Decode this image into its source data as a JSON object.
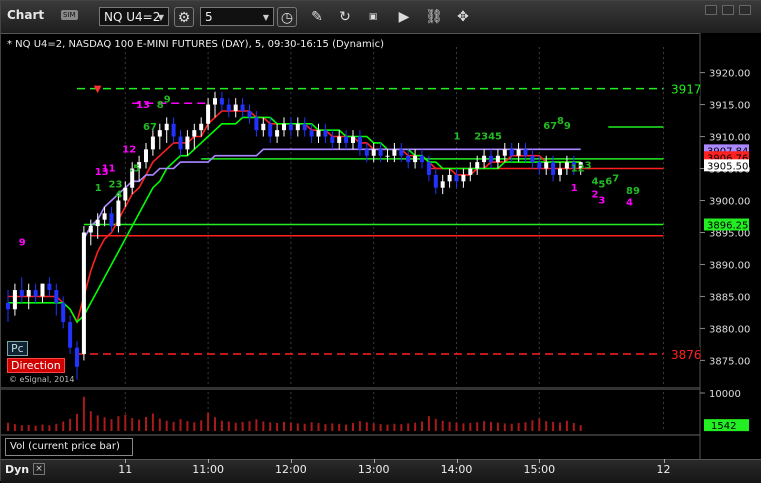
{
  "toolbar": {
    "title": "Chart",
    "sim_badge": "SIM",
    "symbol": "NQ U4=2",
    "interval": "5",
    "icons": [
      "gear-icon",
      "clock-icon",
      "pencil-icon",
      "refresh-icon",
      "get-icon",
      "play-icon",
      "link-icon"
    ]
  },
  "header": {
    "text": "* NQ U4=2, NASDAQ 100 E-MINI FUTURES (DAY), 5, 09:30-16:15 (Dynamic)"
  },
  "badges": {
    "pc": "Pc",
    "direction": "Direction",
    "copyright": "© eSignal, 2014"
  },
  "volume_panel": {
    "label": "Vol (current price bar)"
  },
  "bottom": {
    "dyn": "Dyn"
  },
  "colors": {
    "up_candle": "#ffffff",
    "down_candle": "#2233ff",
    "ema_red": "#ff2020",
    "ema_green": "#00ff00",
    "ma_purple": "#aa88ff",
    "level_green": "#22ee22",
    "level_red": "#ff2020",
    "magenta": "#ff00ff",
    "count_green": "#22bb22"
  },
  "chart_data": {
    "type": "candlestick",
    "ylim": [
      3871,
      3924
    ],
    "y_ticks": [
      3875,
      3880,
      3885,
      3890,
      3895,
      3900,
      3905,
      3910,
      3915,
      3920
    ],
    "x_tick_labels": [
      {
        "label": "11",
        "i": 17
      },
      {
        "label": "11:00",
        "i": 29
      },
      {
        "label": "12:00",
        "i": 41
      },
      {
        "label": "13:00",
        "i": 53
      },
      {
        "label": "14:00",
        "i": 65
      },
      {
        "label": "15:00",
        "i": 77
      },
      {
        "label": "12",
        "i": 95
      }
    ],
    "price_labels": [
      {
        "label": "3917",
        "value": 3917.5,
        "color": "#22ee22"
      },
      {
        "label": "3876",
        "value": 3876,
        "color": "#ff2020"
      },
      {
        "label": "3907.84",
        "value": 3907.84,
        "color": "#aa88ff"
      },
      {
        "label": "3906.76",
        "value": 3906.76,
        "color": "#ff2020"
      },
      {
        "label": "3905.50",
        "value": 3905.5,
        "color": "#ffffff"
      },
      {
        "label": "3896.25",
        "value": 3896.25,
        "color": "#22ee22"
      }
    ],
    "volume_scale": {
      "label": "10000",
      "current": "1542"
    },
    "candles": [
      [
        3884,
        3886,
        3881,
        3883
      ],
      [
        3883,
        3887,
        3882,
        3886
      ],
      [
        3886,
        3888,
        3884,
        3885
      ],
      [
        3885,
        3887,
        3883,
        3886
      ],
      [
        3886,
        3887,
        3884,
        3885
      ],
      [
        3885,
        3887,
        3884,
        3887
      ],
      [
        3887,
        3888,
        3885,
        3886
      ],
      [
        3886,
        3887,
        3882,
        3884
      ],
      [
        3884,
        3885,
        3880,
        3881
      ],
      [
        3881,
        3882,
        3876,
        3877
      ],
      [
        3877,
        3878,
        3872,
        3874
      ],
      [
        3876,
        3896,
        3875,
        3895
      ],
      [
        3895,
        3897,
        3893,
        3896
      ],
      [
        3896,
        3898,
        3894,
        3897
      ],
      [
        3897,
        3899,
        3896,
        3898
      ],
      [
        3898,
        3899,
        3895,
        3896
      ],
      [
        3896,
        3901,
        3895,
        3900
      ],
      [
        3900,
        3903,
        3899,
        3902
      ],
      [
        3902,
        3906,
        3901,
        3905
      ],
      [
        3905,
        3907,
        3903,
        3906
      ],
      [
        3906,
        3909,
        3905,
        3908
      ],
      [
        3908,
        3911,
        3907,
        3910
      ],
      [
        3910,
        3912,
        3908,
        3911
      ],
      [
        3911,
        3913,
        3909,
        3912
      ],
      [
        3912,
        3913,
        3909,
        3910
      ],
      [
        3910,
        3911,
        3907,
        3908
      ],
      [
        3908,
        3911,
        3907,
        3910
      ],
      [
        3910,
        3912,
        3908,
        3911
      ],
      [
        3911,
        3913,
        3910,
        3912
      ],
      [
        3912,
        3916,
        3911,
        3915
      ],
      [
        3915,
        3917,
        3913,
        3916
      ],
      [
        3916,
        3917,
        3914,
        3915
      ],
      [
        3915,
        3916,
        3913,
        3914
      ],
      [
        3914,
        3916,
        3913,
        3915
      ],
      [
        3915,
        3916,
        3913,
        3914
      ],
      [
        3914,
        3915,
        3912,
        3913
      ],
      [
        3913,
        3914,
        3910,
        3911
      ],
      [
        3911,
        3913,
        3910,
        3912
      ],
      [
        3912,
        3913,
        3909,
        3910
      ],
      [
        3910,
        3912,
        3909,
        3911
      ],
      [
        3911,
        3913,
        3910,
        3912
      ],
      [
        3912,
        3913,
        3910,
        3911
      ],
      [
        3911,
        3913,
        3910,
        3912
      ],
      [
        3912,
        3913,
        3910,
        3911
      ],
      [
        3911,
        3912,
        3909,
        3910
      ],
      [
        3910,
        3912,
        3909,
        3911
      ],
      [
        3911,
        3912,
        3909,
        3910
      ],
      [
        3910,
        3911,
        3908,
        3909
      ],
      [
        3909,
        3911,
        3908,
        3910
      ],
      [
        3910,
        3911,
        3908,
        3909
      ],
      [
        3909,
        3911,
        3908,
        3910
      ],
      [
        3910,
        3911,
        3907,
        3908
      ],
      [
        3908,
        3909,
        3906,
        3907
      ],
      [
        3907,
        3909,
        3906,
        3908
      ],
      [
        3908,
        3909,
        3906,
        3907
      ],
      [
        3907,
        3908,
        3906,
        3907
      ],
      [
        3907,
        3909,
        3906,
        3908
      ],
      [
        3908,
        3909,
        3906,
        3907
      ],
      [
        3907,
        3908,
        3905,
        3906
      ],
      [
        3906,
        3908,
        3905,
        3907
      ],
      [
        3907,
        3908,
        3905,
        3906
      ],
      [
        3906,
        3907,
        3903,
        3904
      ],
      [
        3904,
        3905,
        3901,
        3902
      ],
      [
        3902,
        3904,
        3901,
        3903
      ],
      [
        3903,
        3905,
        3902,
        3904
      ],
      [
        3904,
        3905,
        3902,
        3903
      ],
      [
        3903,
        3905,
        3902,
        3904
      ],
      [
        3904,
        3906,
        3903,
        3905
      ],
      [
        3905,
        3907,
        3904,
        3906
      ],
      [
        3906,
        3908,
        3905,
        3907
      ],
      [
        3907,
        3908,
        3905,
        3906
      ],
      [
        3906,
        3908,
        3905,
        3907
      ],
      [
        3907,
        3909,
        3906,
        3908
      ],
      [
        3908,
        3909,
        3906,
        3907
      ],
      [
        3907,
        3909,
        3906,
        3908
      ],
      [
        3908,
        3909,
        3906,
        3907
      ],
      [
        3907,
        3908,
        3905,
        3906
      ],
      [
        3906,
        3907,
        3904,
        3905
      ],
      [
        3905,
        3907,
        3904,
        3906
      ],
      [
        3906,
        3907,
        3903,
        3904
      ],
      [
        3904,
        3906,
        3903,
        3905
      ],
      [
        3905,
        3907,
        3904,
        3906
      ],
      [
        3906,
        3907,
        3904,
        3905
      ],
      [
        3905,
        3906,
        3904,
        3906
      ]
    ],
    "volumes": [
      2200,
      1800,
      1500,
      1600,
      1400,
      1700,
      1500,
      1900,
      2500,
      3200,
      4500,
      9000,
      5200,
      4100,
      3600,
      3100,
      3900,
      4300,
      3400,
      3000,
      3700,
      4600,
      3300,
      2700,
      2400,
      3100,
      2600,
      2300,
      2800,
      4800,
      3600,
      2700,
      2500,
      2200,
      2400,
      2600,
      3100,
      2500,
      2300,
      2100,
      2400,
      2200,
      2000,
      1900,
      2300,
      2100,
      1800,
      2000,
      1900,
      1700,
      2100,
      2600,
      2300,
      2000,
      1800,
      1700,
      1900,
      1800,
      2000,
      2200,
      2500,
      3900,
      3200,
      2700,
      2400,
      2200,
      2000,
      2100,
      2300,
      2600,
      2400,
      2200,
      2000,
      1900,
      2100,
      2300,
      2800,
      3300,
      2600,
      2400,
      2200,
      2700,
      2100,
      1542
    ],
    "series": [
      {
        "name": "",
        "kind": "ema_red",
        "values": [
          3885,
          3885,
          3885,
          3885,
          3885,
          3885,
          3885,
          3885,
          3884,
          3883,
          3881,
          3885,
          3889,
          3892,
          3894,
          3895,
          3897,
          3899,
          3901,
          3902,
          3904,
          3906,
          3907,
          3908,
          3909,
          3909,
          3909,
          3910,
          3910,
          3912,
          3913,
          3914,
          3914,
          3914,
          3914,
          3914,
          3913,
          3913,
          3912,
          3912,
          3912,
          3912,
          3912,
          3912,
          3911,
          3911,
          3911,
          3910,
          3910,
          3910,
          3910,
          3909,
          3909,
          3908,
          3908,
          3908,
          3908,
          3908,
          3907,
          3907,
          3907,
          3906,
          3905,
          3905,
          3905,
          3904,
          3904,
          3904,
          3905,
          3905,
          3906,
          3906,
          3906,
          3907,
          3907,
          3907,
          3907,
          3907,
          3906,
          3906,
          3906,
          3906,
          3906,
          3906
        ]
      },
      {
        "name": "",
        "kind": "ema_green",
        "values": [
          3884,
          3884,
          3884,
          3884,
          3884,
          3884,
          3884,
          3884,
          3884,
          3883,
          3881,
          3882,
          3884,
          3886,
          3888,
          3890,
          3892,
          3894,
          3896,
          3898,
          3900,
          3902,
          3903,
          3905,
          3906,
          3907,
          3907,
          3908,
          3909,
          3910,
          3911,
          3912,
          3912,
          3912,
          3913,
          3913,
          3913,
          3913,
          3913,
          3912,
          3912,
          3912,
          3912,
          3912,
          3912,
          3911,
          3911,
          3911,
          3911,
          3910,
          3910,
          3910,
          3910,
          3909,
          3909,
          3908,
          3908,
          3908,
          3908,
          3907,
          3907,
          3906,
          3906,
          3905,
          3905,
          3905,
          3905,
          3905,
          3905,
          3905,
          3905,
          3905,
          3906,
          3906,
          3906,
          3906,
          3906,
          3906,
          3906,
          3906,
          3906,
          3906,
          3906,
          3906
        ]
      },
      {
        "name": "",
        "kind": "ma_purple",
        "values": [
          null,
          null,
          null,
          null,
          null,
          null,
          null,
          null,
          null,
          null,
          null,
          3894,
          3896,
          3897,
          3899,
          3900,
          3901,
          3902,
          3903,
          3903,
          3904,
          3904,
          3905,
          3905,
          3905,
          3906,
          3906,
          3906,
          3906,
          3906,
          3907,
          3907,
          3907,
          3907,
          3907,
          3907,
          3907,
          3908,
          3908,
          3908,
          3908,
          3908,
          3908,
          3908,
          3908,
          3908,
          3908,
          3908,
          3908,
          3908,
          3908,
          3908,
          3908,
          3908,
          3908,
          3908,
          3908,
          3908,
          3908,
          3908,
          3908,
          3908,
          3908,
          3908,
          3908,
          3908,
          3908,
          3908,
          3908,
          3908,
          3908,
          3908,
          3908,
          3908,
          3908,
          3908,
          3908,
          3908,
          3908,
          3908,
          3908,
          3908,
          3908,
          3908
        ]
      }
    ],
    "levels": [
      {
        "value": 3917.5,
        "color": "#22ee22",
        "dashed": true,
        "from": 10,
        "to": 95
      },
      {
        "value": 3876,
        "color": "#ff2020",
        "dashed": true,
        "from": 10,
        "to": 95
      },
      {
        "value": 3896.25,
        "color": "#22ee22",
        "dashed": false,
        "from": 11,
        "to": 95
      },
      {
        "value": 3894.5,
        "color": "#ff2020",
        "dashed": false,
        "from": 12,
        "to": 95
      },
      {
        "value": 3906.5,
        "color": "#22ee22",
        "dashed": false,
        "from": 28,
        "to": 95
      },
      {
        "value": 3905,
        "color": "#ff2020",
        "dashed": false,
        "from": 61,
        "to": 95
      },
      {
        "value": 3915.2,
        "color": "#ff00ff",
        "dashed": true,
        "from": 18,
        "to": 29
      },
      {
        "value": 3911.5,
        "color": "#22ee22",
        "dashed": false,
        "from": 87,
        "to": 95
      }
    ],
    "annotations": [
      {
        "text": "9",
        "i": 2,
        "value": 3893,
        "color": "#ff00ff"
      },
      {
        "text": "13",
        "i": 13,
        "value": 3904,
        "color": "#ff00ff"
      },
      {
        "text": "11",
        "i": 14,
        "value": 3904.5,
        "color": "#ff00ff"
      },
      {
        "text": "1",
        "i": 13,
        "value": 3901.5,
        "color": "#22bb22"
      },
      {
        "text": "23",
        "i": 15,
        "value": 3902,
        "color": "#22bb22"
      },
      {
        "text": "4",
        "i": 16,
        "value": 3900.5,
        "color": "#22bb22"
      },
      {
        "text": ".5",
        "i": 18,
        "value": 3904.5,
        "color": "#22bb22"
      },
      {
        "text": "12",
        "i": 17,
        "value": 3907.5,
        "color": "#ff00ff"
      },
      {
        "text": "13",
        "i": 19,
        "value": 3914.5,
        "color": "#ff00ff"
      },
      {
        "text": "67",
        "i": 20,
        "value": 3911,
        "color": "#22bb22"
      },
      {
        "text": "8",
        "i": 22,
        "value": 3914.5,
        "color": "#22bb22"
      },
      {
        "text": "9",
        "i": 23,
        "value": 3915.3,
        "color": "#22bb22"
      },
      {
        "text": "1",
        "i": 65,
        "value": 3909.5,
        "color": "#22bb22"
      },
      {
        "text": "2345",
        "i": 68,
        "value": 3909.5,
        "color": "#22bb22"
      },
      {
        "text": "67",
        "i": 78,
        "value": 3911.2,
        "color": "#22bb22"
      },
      {
        "text": "8",
        "i": 80,
        "value": 3912,
        "color": "#22bb22"
      },
      {
        "text": "9",
        "i": 81,
        "value": 3911.2,
        "color": "#22bb22"
      },
      {
        "text": "12",
        "i": 82,
        "value": 3904.5,
        "color": "#22bb22"
      },
      {
        "text": "3",
        "i": 84,
        "value": 3905,
        "color": "#22bb22"
      },
      {
        "text": "4",
        "i": 85,
        "value": 3902.5,
        "color": "#22bb22"
      },
      {
        "text": "5",
        "i": 86,
        "value": 3902,
        "color": "#22bb22"
      },
      {
        "text": "6",
        "i": 87,
        "value": 3902.5,
        "color": "#22bb22"
      },
      {
        "text": "7",
        "i": 88,
        "value": 3903,
        "color": "#22bb22"
      },
      {
        "text": "89",
        "i": 90,
        "value": 3901,
        "color": "#22bb22"
      },
      {
        "text": "1",
        "i": 82,
        "value": 3901.5,
        "color": "#ff00ff"
      },
      {
        "text": "2",
        "i": 85,
        "value": 3900.5,
        "color": "#ff00ff"
      },
      {
        "text": "3",
        "i": 86,
        "value": 3899.5,
        "color": "#ff00ff"
      },
      {
        "text": "4",
        "i": 90,
        "value": 3899.2,
        "color": "#ff00ff"
      }
    ],
    "down_arrow": {
      "i": 13,
      "value": 3917
    }
  }
}
